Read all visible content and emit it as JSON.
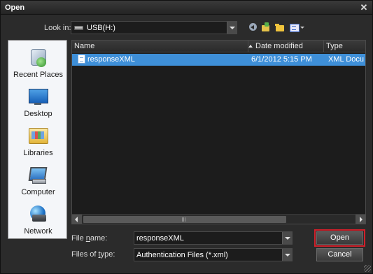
{
  "window": {
    "title": "Open",
    "close_glyph": "✕"
  },
  "look_in": {
    "label": "Look in:",
    "value": "USB(H:)"
  },
  "places": [
    {
      "label": "Recent Places",
      "icon": "recent-places-icon"
    },
    {
      "label": "Desktop",
      "icon": "desktop-icon"
    },
    {
      "label": "Libraries",
      "icon": "libraries-icon"
    },
    {
      "label": "Computer",
      "icon": "computer-icon"
    },
    {
      "label": "Network",
      "icon": "network-icon"
    }
  ],
  "file_list": {
    "columns": {
      "name": "Name",
      "date": "Date modified",
      "type": "Type"
    },
    "sort_column": "date",
    "rows": [
      {
        "name": "responseXML",
        "date": "6/1/2012 5:15 PM",
        "type": "XML Docu",
        "selected": true
      }
    ]
  },
  "file_name": {
    "label_pre": "File ",
    "label_key": "n",
    "label_post": "ame:",
    "value": "responseXML"
  },
  "file_type": {
    "label_pre": "Files of ",
    "label_key": "t",
    "label_post": "ype:",
    "value": "Authentication Files (*.xml)"
  },
  "buttons": {
    "open": "Open",
    "cancel": "Cancel"
  },
  "colors": {
    "selection": "#3e8fd8",
    "highlight_outline": "#d0202a",
    "background": "#2b2b2b"
  }
}
